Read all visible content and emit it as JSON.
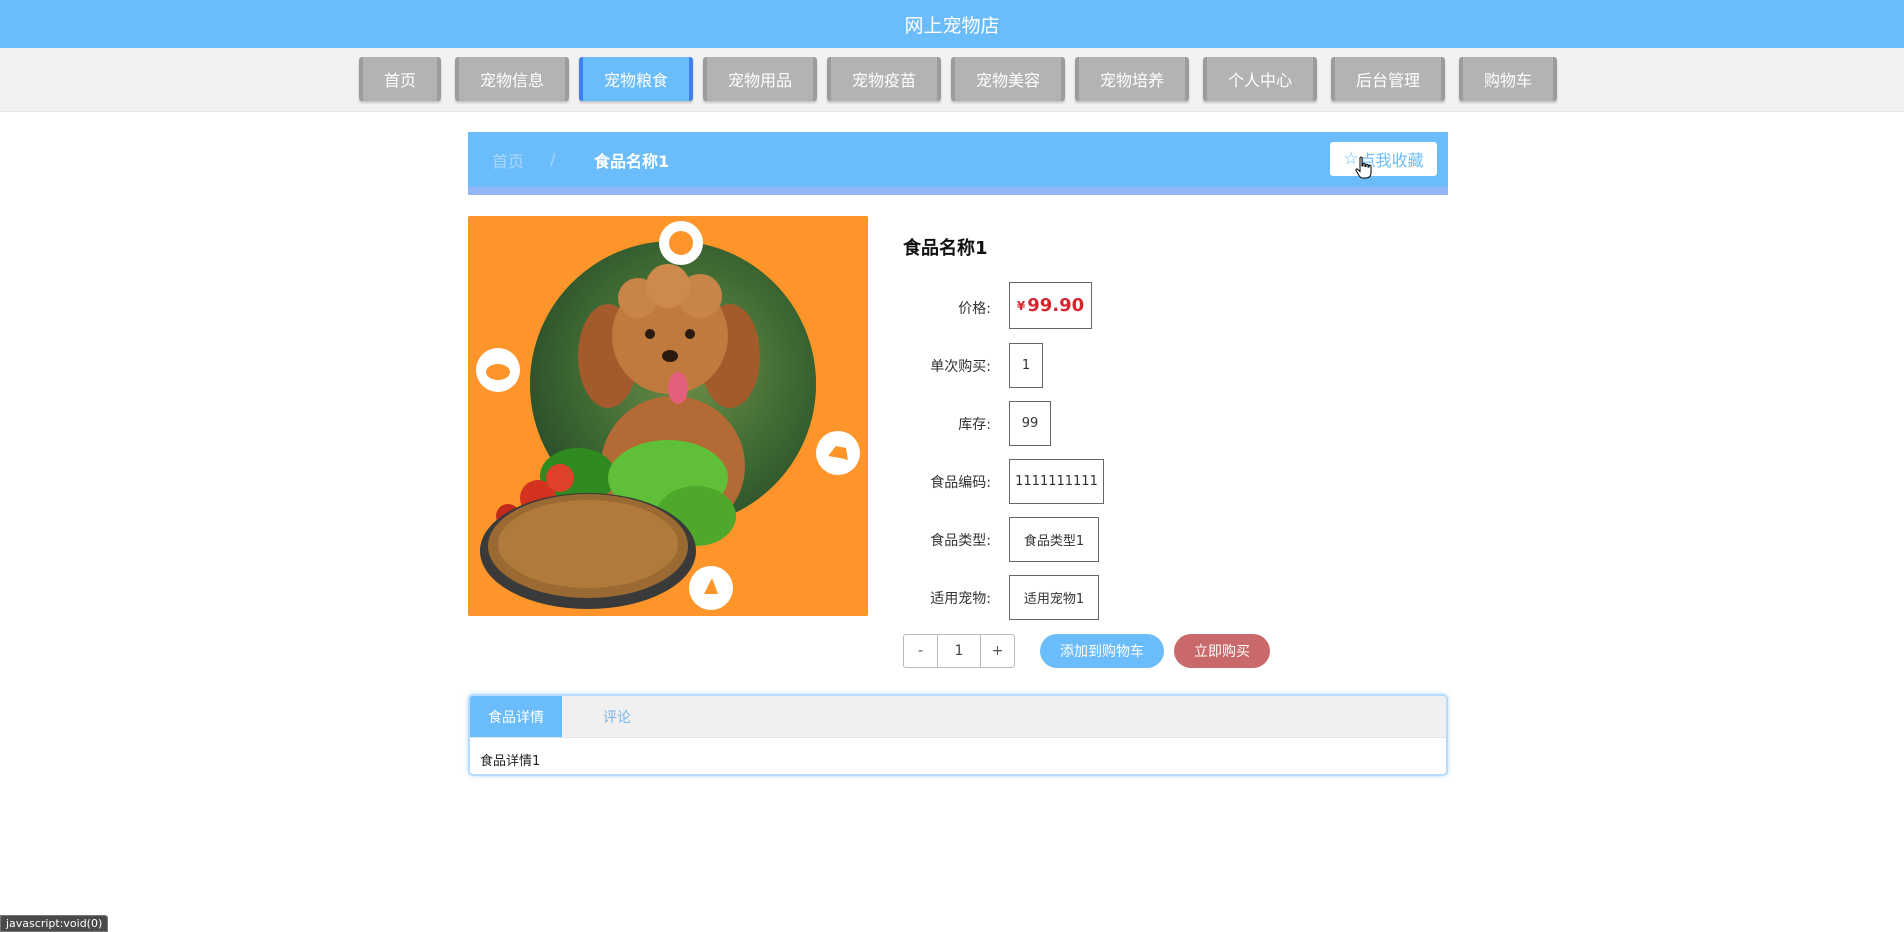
{
  "header": {
    "title": "网上宠物店"
  },
  "nav": {
    "items": [
      {
        "label": "首页"
      },
      {
        "label": "宠物信息"
      },
      {
        "label": "宠物粮食"
      },
      {
        "label": "宠物用品"
      },
      {
        "label": "宠物疫苗"
      },
      {
        "label": "宠物美容"
      },
      {
        "label": "宠物培养"
      },
      {
        "label": "个人中心"
      },
      {
        "label": "后台管理"
      },
      {
        "label": "购物车"
      }
    ],
    "active": "宠物粮食"
  },
  "breadcrumb": {
    "home": "首页",
    "separator": "/",
    "current": "食品名称1",
    "favorite_label": "点我收藏",
    "favorite_icon": "star-outline-icon"
  },
  "product": {
    "title": "食品名称1",
    "image_alt": "dog-food-product-image",
    "fields": {
      "price_label": "价格:",
      "price_symbol": "¥",
      "price_value": "99.90",
      "per_purchase_label": "单次购买:",
      "per_purchase_value": "1",
      "stock_label": "库存:",
      "stock_value": "99",
      "code_label": "食品编码:",
      "code_value": "1111111111",
      "type_label": "食品类型:",
      "type_value": "食品类型1",
      "pet_label": "适用宠物:",
      "pet_value": "适用宠物1"
    },
    "quantity": {
      "minus": "-",
      "value": "1",
      "plus": "+"
    },
    "add_to_cart": "添加到购物车",
    "buy_now": "立即购买"
  },
  "tabs": {
    "items": [
      {
        "label": "食品详情"
      },
      {
        "label": "评论"
      }
    ],
    "active_content": "食品详情1"
  },
  "status_bar": {
    "text": "javascript:void(0)"
  },
  "colors": {
    "primary": "#6bbcfb",
    "nav_inactive": "#b3b3b3",
    "price": "#d8262f",
    "buy_now": "#c9696b",
    "image_bg": "#fd952a"
  }
}
